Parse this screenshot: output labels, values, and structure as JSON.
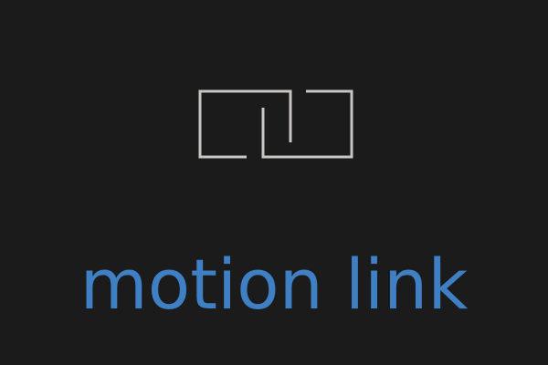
{
  "brand": {
    "name": "motion link",
    "icon": "interlocking-brackets-icon",
    "text_color": "#3f7fc4",
    "icon_color": "#c8c6c0",
    "background_color": "#1b1b1b"
  }
}
